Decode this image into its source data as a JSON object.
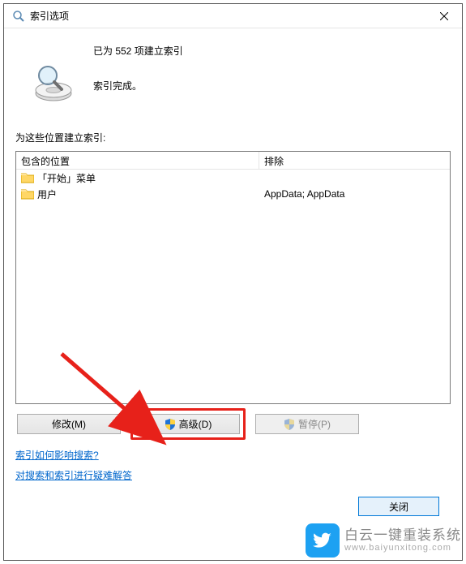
{
  "titlebar": {
    "title": "索引选项"
  },
  "status": {
    "line1": "已为 552 项建立索引",
    "line2": "索引完成。"
  },
  "locations": {
    "section_label": "为这些位置建立索引:",
    "header_included": "包含的位置",
    "header_excluded": "排除",
    "rows": [
      {
        "included": "「开始」菜单",
        "excluded": ""
      },
      {
        "included": "用户",
        "excluded": "AppData; AppData"
      }
    ]
  },
  "buttons": {
    "modify": "修改(M)",
    "advanced": "高级(D)",
    "pause": "暂停(P)",
    "close": "关闭"
  },
  "links": {
    "help_search": "索引如何影响搜索?",
    "troubleshoot": "对搜索和索引进行疑难解答"
  },
  "watermark": {
    "brand": "白云一键重装系统",
    "url": "www.baiyunxitong.com"
  }
}
